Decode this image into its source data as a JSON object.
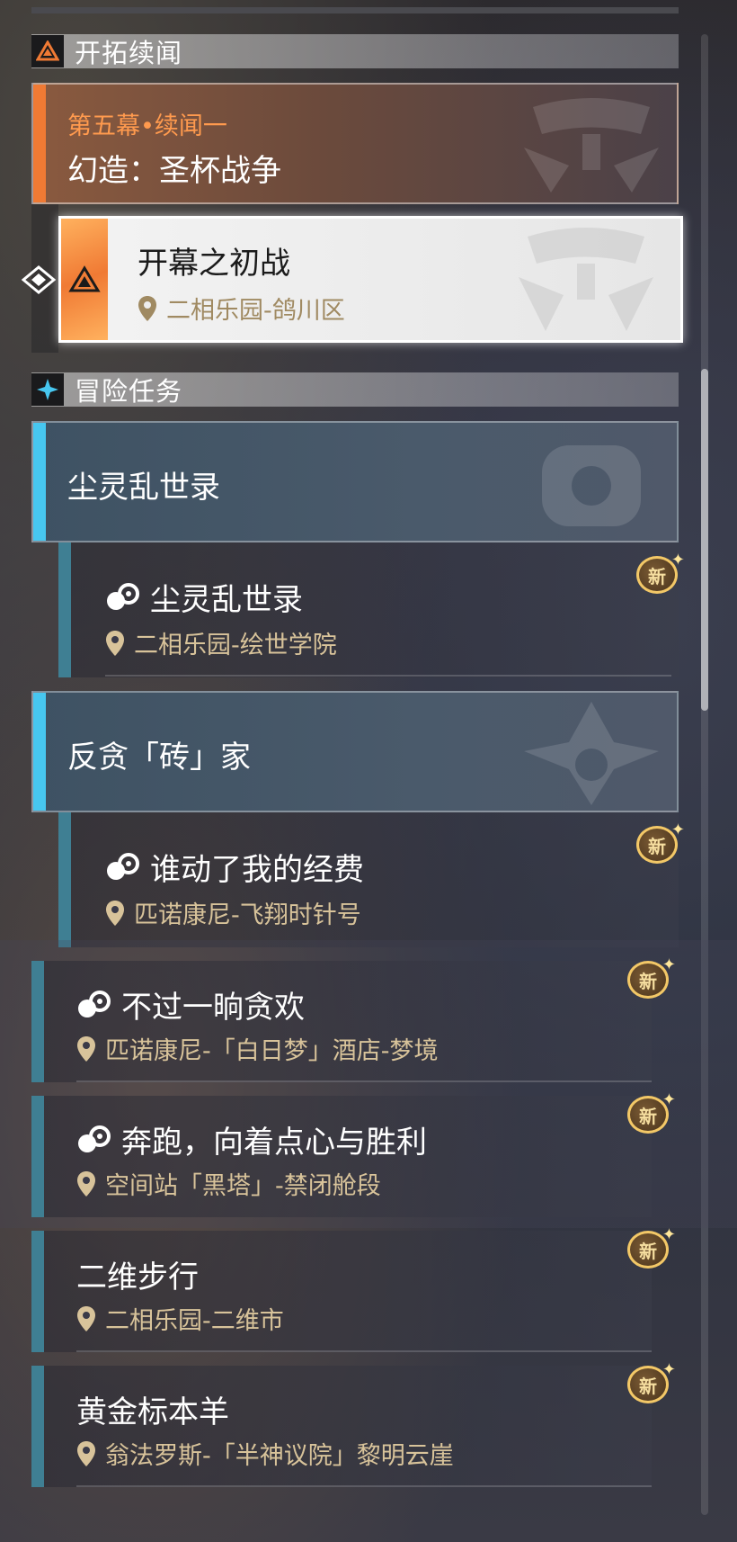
{
  "trailblaze": {
    "header": "开拓续闻",
    "card": {
      "subtitle": "第五幕•续闻一",
      "title": "幻造：圣杯战争"
    },
    "selected": {
      "title": "开幕之初战",
      "location": "二相乐园-鸽川区"
    }
  },
  "adventure": {
    "header": "冒险任务",
    "groups": [
      {
        "title": "尘灵乱世录",
        "quests": [
          {
            "title": "尘灵乱世录",
            "location": "二相乐园-绘世学院",
            "badge": "新"
          }
        ]
      },
      {
        "title": "反贪「砖」家",
        "quests": [
          {
            "title": "谁动了我的经费",
            "location": "匹诺康尼-飞翔时针号",
            "badge": "新"
          }
        ]
      }
    ],
    "quests": [
      {
        "title": "不过一晌贪欢",
        "location": "匹诺康尼-「白日梦」酒店-梦境",
        "badge": "新"
      },
      {
        "title": "奔跑，向着点心与胜利",
        "location": "空间站「黑塔」-禁闭舱段",
        "badge": "新"
      },
      {
        "title": "二维步行",
        "location": "二相乐园-二维市",
        "badge": "新"
      },
      {
        "title": "黄金标本羊",
        "location": "翁法罗斯-「半神议院」黎明云崖",
        "badge": "新"
      }
    ]
  },
  "colors": {
    "trailblaze_accent": "#f07a34",
    "adventure_accent": "#47c7f0",
    "quest_accent": "#3f7f93",
    "location_text": "#d8c39a",
    "badge_gold": "#f3c867"
  },
  "icons": {
    "trailblaze": "trailblaze-triangle-icon",
    "adventure": "adventure-star-icon",
    "quest": "adventure-quest-icon",
    "location": "location-pin-icon",
    "selected": "selected-diamond-icon",
    "new_badge": "new-badge-icon"
  }
}
